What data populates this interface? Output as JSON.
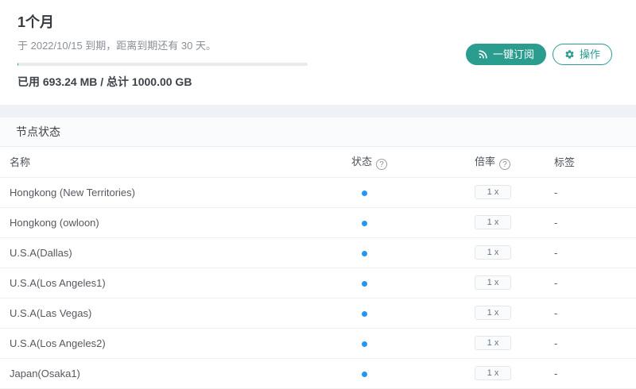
{
  "plan": {
    "title": "1个月",
    "expiry_text": "于 2022/10/15 到期，距离到期还有 30 天。",
    "usage_text": "已用 693.24 MB / 总计 1000.00 GB",
    "progress_percent": 0.07
  },
  "actions": {
    "subscribe_label": "一键订阅",
    "operations_label": "操作"
  },
  "node_section": {
    "title": "节点状态",
    "columns": {
      "name": "名称",
      "status": "状态",
      "rate": "倍率",
      "tags": "标签"
    },
    "help_glyph": "?",
    "rows": [
      {
        "name": "Hongkong (New Territories)",
        "status": "online",
        "rate": "1 x",
        "tags": "-"
      },
      {
        "name": "Hongkong (owloon)",
        "status": "online",
        "rate": "1 x",
        "tags": "-"
      },
      {
        "name": "U.S.A(Dallas)",
        "status": "online",
        "rate": "1 x",
        "tags": "-"
      },
      {
        "name": "U.S.A(Los Angeles1)",
        "status": "online",
        "rate": "1 x",
        "tags": "-"
      },
      {
        "name": "U.S.A(Las Vegas)",
        "status": "online",
        "rate": "1 x",
        "tags": "-"
      },
      {
        "name": "U.S.A(Los Angeles2)",
        "status": "online",
        "rate": "1 x",
        "tags": "-"
      },
      {
        "name": "Japan(Osaka1)",
        "status": "online",
        "rate": "1 x",
        "tags": "-"
      }
    ]
  },
  "colors": {
    "accent_teal": "#2a9d8f",
    "status_online_blue": "#2196f3",
    "page_background": "#eef2f7"
  }
}
